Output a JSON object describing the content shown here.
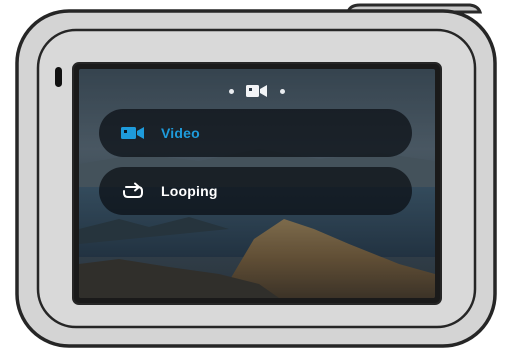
{
  "screen": {
    "mode_indicator": {
      "icon": "video-camera-icon"
    },
    "menu": {
      "items": [
        {
          "label": "Video",
          "icon": "video-camera-icon",
          "selected": true
        },
        {
          "label": "Looping",
          "icon": "loop-arrow-icon",
          "selected": false
        }
      ]
    }
  },
  "colors": {
    "selected_accent": "#1e9bdb",
    "menu_text": "#ffffff",
    "device_body": "#d6d6d6",
    "device_outline": "#2a2a2a"
  }
}
